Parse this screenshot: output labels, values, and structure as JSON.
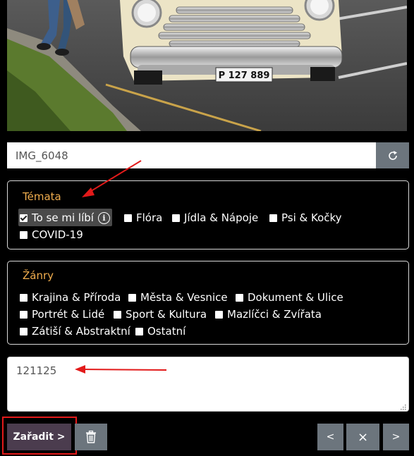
{
  "photo": {
    "plate_text": "P 127 889"
  },
  "file": {
    "name_value": "IMG_6048",
    "refresh_icon": "refresh-icon"
  },
  "topics": {
    "title": "Témata",
    "items": [
      {
        "label": "To se mi líbí",
        "checked": true
      },
      {
        "label": "Flóra",
        "checked": false
      },
      {
        "label": "Jídla & Nápoje",
        "checked": false
      },
      {
        "label": "Psi & Kočky",
        "checked": false
      },
      {
        "label": "COVID-19",
        "checked": false
      }
    ],
    "info_glyph": "i"
  },
  "genres": {
    "title": "Žánry",
    "items": [
      {
        "label": "Krajina & Příroda",
        "checked": false
      },
      {
        "label": "Města & Vesnice",
        "checked": false
      },
      {
        "label": "Dokument & Ulice",
        "checked": false
      },
      {
        "label": "Portrét & Lidé",
        "checked": false
      },
      {
        "label": "Sport & Kultura",
        "checked": false
      },
      {
        "label": "Mazlíčci & Zvířata",
        "checked": false
      },
      {
        "label": "Zátiší & Abstraktní",
        "checked": false
      },
      {
        "label": "Ostatní",
        "checked": false
      }
    ]
  },
  "notes": {
    "value": "121125"
  },
  "actions": {
    "classify_label": "Zařadit >",
    "prev_label": "<",
    "close_label": "×",
    "next_label": ">"
  },
  "colors": {
    "accent_title": "#f0ad4e",
    "button_gray": "#6c757d",
    "classify_bg": "#4b3c4e",
    "annotation_red": "#e21a1a"
  }
}
